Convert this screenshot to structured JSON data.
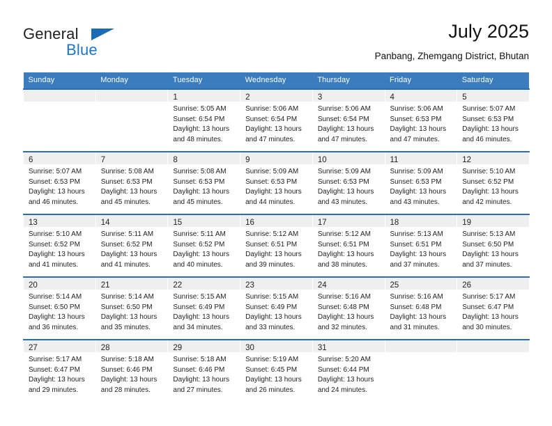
{
  "brand": {
    "name_part1": "General",
    "name_part2": "Blue",
    "triangle_icon": "triangle-logo-icon",
    "accent_color": "#1b76cb"
  },
  "header": {
    "title": "July 2025",
    "subtitle": "Panbang, Zhemgang District, Bhutan"
  },
  "theme": {
    "header_row_bg": "#3b7cbe",
    "row_divider": "#2a6db5",
    "daynum_band_bg": "#efefef"
  },
  "weekdays": [
    "Sunday",
    "Monday",
    "Tuesday",
    "Wednesday",
    "Thursday",
    "Friday",
    "Saturday"
  ],
  "weeks": [
    [
      {
        "day": "",
        "lines": []
      },
      {
        "day": "",
        "lines": []
      },
      {
        "day": "1",
        "lines": [
          "Sunrise: 5:05 AM",
          "Sunset: 6:54 PM",
          "Daylight: 13 hours",
          "and 48 minutes."
        ]
      },
      {
        "day": "2",
        "lines": [
          "Sunrise: 5:06 AM",
          "Sunset: 6:54 PM",
          "Daylight: 13 hours",
          "and 47 minutes."
        ]
      },
      {
        "day": "3",
        "lines": [
          "Sunrise: 5:06 AM",
          "Sunset: 6:54 PM",
          "Daylight: 13 hours",
          "and 47 minutes."
        ]
      },
      {
        "day": "4",
        "lines": [
          "Sunrise: 5:06 AM",
          "Sunset: 6:53 PM",
          "Daylight: 13 hours",
          "and 47 minutes."
        ]
      },
      {
        "day": "5",
        "lines": [
          "Sunrise: 5:07 AM",
          "Sunset: 6:53 PM",
          "Daylight: 13 hours",
          "and 46 minutes."
        ]
      }
    ],
    [
      {
        "day": "6",
        "lines": [
          "Sunrise: 5:07 AM",
          "Sunset: 6:53 PM",
          "Daylight: 13 hours",
          "and 46 minutes."
        ]
      },
      {
        "day": "7",
        "lines": [
          "Sunrise: 5:08 AM",
          "Sunset: 6:53 PM",
          "Daylight: 13 hours",
          "and 45 minutes."
        ]
      },
      {
        "day": "8",
        "lines": [
          "Sunrise: 5:08 AM",
          "Sunset: 6:53 PM",
          "Daylight: 13 hours",
          "and 45 minutes."
        ]
      },
      {
        "day": "9",
        "lines": [
          "Sunrise: 5:09 AM",
          "Sunset: 6:53 PM",
          "Daylight: 13 hours",
          "and 44 minutes."
        ]
      },
      {
        "day": "10",
        "lines": [
          "Sunrise: 5:09 AM",
          "Sunset: 6:53 PM",
          "Daylight: 13 hours",
          "and 43 minutes."
        ]
      },
      {
        "day": "11",
        "lines": [
          "Sunrise: 5:09 AM",
          "Sunset: 6:53 PM",
          "Daylight: 13 hours",
          "and 43 minutes."
        ]
      },
      {
        "day": "12",
        "lines": [
          "Sunrise: 5:10 AM",
          "Sunset: 6:52 PM",
          "Daylight: 13 hours",
          "and 42 minutes."
        ]
      }
    ],
    [
      {
        "day": "13",
        "lines": [
          "Sunrise: 5:10 AM",
          "Sunset: 6:52 PM",
          "Daylight: 13 hours",
          "and 41 minutes."
        ]
      },
      {
        "day": "14",
        "lines": [
          "Sunrise: 5:11 AM",
          "Sunset: 6:52 PM",
          "Daylight: 13 hours",
          "and 41 minutes."
        ]
      },
      {
        "day": "15",
        "lines": [
          "Sunrise: 5:11 AM",
          "Sunset: 6:52 PM",
          "Daylight: 13 hours",
          "and 40 minutes."
        ]
      },
      {
        "day": "16",
        "lines": [
          "Sunrise: 5:12 AM",
          "Sunset: 6:51 PM",
          "Daylight: 13 hours",
          "and 39 minutes."
        ]
      },
      {
        "day": "17",
        "lines": [
          "Sunrise: 5:12 AM",
          "Sunset: 6:51 PM",
          "Daylight: 13 hours",
          "and 38 minutes."
        ]
      },
      {
        "day": "18",
        "lines": [
          "Sunrise: 5:13 AM",
          "Sunset: 6:51 PM",
          "Daylight: 13 hours",
          "and 37 minutes."
        ]
      },
      {
        "day": "19",
        "lines": [
          "Sunrise: 5:13 AM",
          "Sunset: 6:50 PM",
          "Daylight: 13 hours",
          "and 37 minutes."
        ]
      }
    ],
    [
      {
        "day": "20",
        "lines": [
          "Sunrise: 5:14 AM",
          "Sunset: 6:50 PM",
          "Daylight: 13 hours",
          "and 36 minutes."
        ]
      },
      {
        "day": "21",
        "lines": [
          "Sunrise: 5:14 AM",
          "Sunset: 6:50 PM",
          "Daylight: 13 hours",
          "and 35 minutes."
        ]
      },
      {
        "day": "22",
        "lines": [
          "Sunrise: 5:15 AM",
          "Sunset: 6:49 PM",
          "Daylight: 13 hours",
          "and 34 minutes."
        ]
      },
      {
        "day": "23",
        "lines": [
          "Sunrise: 5:15 AM",
          "Sunset: 6:49 PM",
          "Daylight: 13 hours",
          "and 33 minutes."
        ]
      },
      {
        "day": "24",
        "lines": [
          "Sunrise: 5:16 AM",
          "Sunset: 6:48 PM",
          "Daylight: 13 hours",
          "and 32 minutes."
        ]
      },
      {
        "day": "25",
        "lines": [
          "Sunrise: 5:16 AM",
          "Sunset: 6:48 PM",
          "Daylight: 13 hours",
          "and 31 minutes."
        ]
      },
      {
        "day": "26",
        "lines": [
          "Sunrise: 5:17 AM",
          "Sunset: 6:47 PM",
          "Daylight: 13 hours",
          "and 30 minutes."
        ]
      }
    ],
    [
      {
        "day": "27",
        "lines": [
          "Sunrise: 5:17 AM",
          "Sunset: 6:47 PM",
          "Daylight: 13 hours",
          "and 29 minutes."
        ]
      },
      {
        "day": "28",
        "lines": [
          "Sunrise: 5:18 AM",
          "Sunset: 6:46 PM",
          "Daylight: 13 hours",
          "and 28 minutes."
        ]
      },
      {
        "day": "29",
        "lines": [
          "Sunrise: 5:18 AM",
          "Sunset: 6:46 PM",
          "Daylight: 13 hours",
          "and 27 minutes."
        ]
      },
      {
        "day": "30",
        "lines": [
          "Sunrise: 5:19 AM",
          "Sunset: 6:45 PM",
          "Daylight: 13 hours",
          "and 26 minutes."
        ]
      },
      {
        "day": "31",
        "lines": [
          "Sunrise: 5:20 AM",
          "Sunset: 6:44 PM",
          "Daylight: 13 hours",
          "and 24 minutes."
        ]
      },
      {
        "day": "",
        "lines": []
      },
      {
        "day": "",
        "lines": []
      }
    ]
  ]
}
